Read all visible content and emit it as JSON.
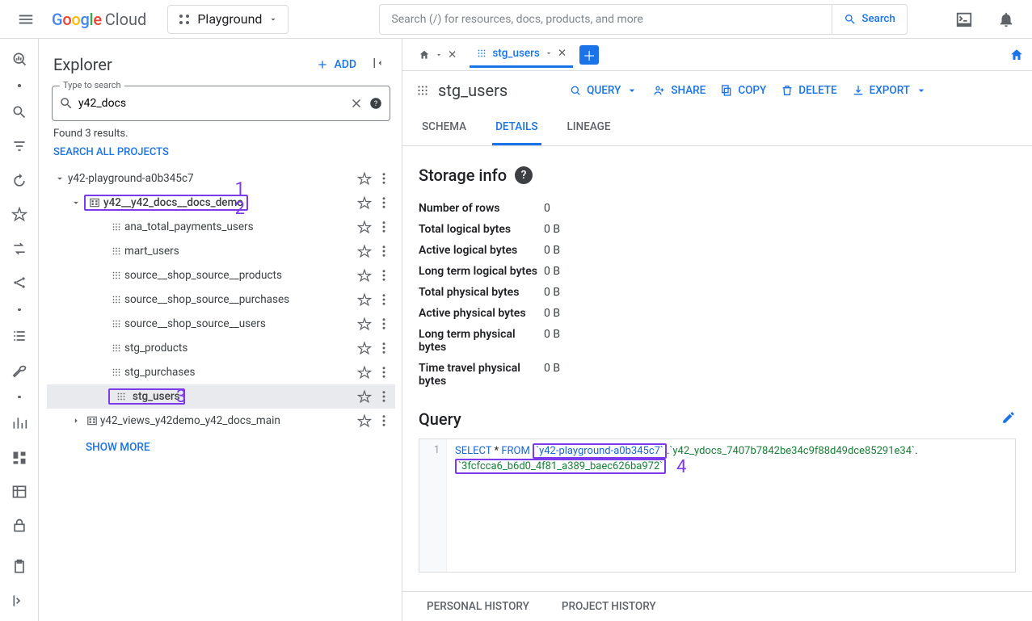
{
  "topbar": {
    "brand_cloud": "Cloud",
    "project": "Playground",
    "search_placeholder": "Search (/) for resources, docs, products, and more",
    "search_btn": "Search"
  },
  "explorer": {
    "title": "Explorer",
    "add": "ADD",
    "search_label": "Type to search",
    "search_value": "y42_docs",
    "results": "Found 3 results.",
    "search_all": "SEARCH ALL PROJECTS",
    "show_more": "SHOW MORE",
    "project": "y42-playground-a0b345c7",
    "dataset_hl": "y42__y42_docs__docs_demo",
    "tables": [
      "ana_total_payments_users",
      "mart_users",
      "source__shop_source__products",
      "source__shop_source__purchases",
      "source__shop_source__users",
      "stg_products",
      "stg_purchases"
    ],
    "table_hl": "stg_users",
    "dataset2": "y42_views_y42demo_y42_docs_main"
  },
  "tabs": {
    "active": "stg_users"
  },
  "object": {
    "name": "stg_users",
    "actions": {
      "query": "QUERY",
      "share": "SHARE",
      "copy": "COPY",
      "delete": "DELETE",
      "export": "EXPORT"
    },
    "subtabs": {
      "schema": "SCHEMA",
      "details": "DETAILS",
      "lineage": "LINEAGE"
    }
  },
  "storage": {
    "heading": "Storage info",
    "rows": [
      {
        "k": "Number of rows",
        "v": "0"
      },
      {
        "k": "Total logical bytes",
        "v": "0 B"
      },
      {
        "k": "Active logical bytes",
        "v": "0 B"
      },
      {
        "k": "Long term logical bytes",
        "v": "0 B"
      },
      {
        "k": "Total physical bytes",
        "v": "0 B"
      },
      {
        "k": "Active physical bytes",
        "v": "0 B"
      },
      {
        "k": "Long term physical bytes",
        "v": "0 B"
      },
      {
        "k": "Time travel physical bytes",
        "v": "0 B"
      }
    ]
  },
  "query": {
    "heading": "Query",
    "line_no": "1",
    "select": "SELECT",
    "star": " * ",
    "from": "FROM",
    "seg1": "`y42-playground-a0b345c7`",
    "dot": ".",
    "seg2": "`y42_ydocs_7407b7842be34c9f88d49dce85291e34`",
    "seg3": "`3fcfcca6_b6d0_4f81_a389_baec626ba972`"
  },
  "history": {
    "personal": "PERSONAL HISTORY",
    "project": "PROJECT HISTORY"
  },
  "callouts": {
    "c1": "1",
    "c2": "2",
    "c3": "3",
    "c4": "4"
  }
}
